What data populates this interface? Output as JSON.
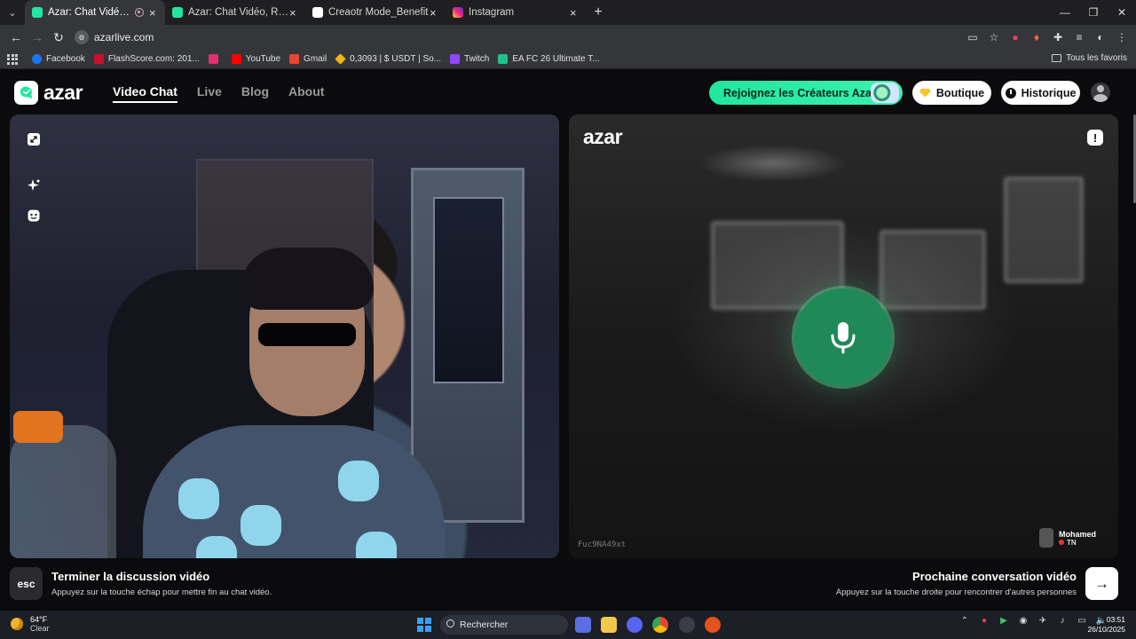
{
  "browser": {
    "tabs": [
      {
        "title": "Azar: Chat Vidéo, Rencontrer...",
        "active": true,
        "favicon_color": "#22e6a0",
        "recording": true
      },
      {
        "title": "Azar: Chat Vidéo, Rencontrer de...",
        "active": false,
        "favicon_color": "#22e6a0"
      },
      {
        "title": "Creaotr Mode_Benefit",
        "active": false,
        "favicon_color": "#ffffff"
      },
      {
        "title": "Instagram",
        "active": false,
        "favicon_color": "#e1306c"
      }
    ],
    "url": "azarlive.com",
    "bookmarks": [
      {
        "label": "Facebook",
        "color": "#1877f2"
      },
      {
        "label": "FlashScore.com: 201...",
        "color": "#c8102e"
      },
      {
        "label": "",
        "color": "#e1306c"
      },
      {
        "label": "YouTube",
        "color": "#ff0000"
      },
      {
        "label": "Gmail",
        "color": "#ea4335"
      },
      {
        "label": "0,3093 | $ USDT | So...",
        "color": "#f0b90b"
      },
      {
        "label": "Twitch",
        "color": "#9146ff"
      },
      {
        "label": "EA FC 26 Ultimate T...",
        "color": "#1ec38b"
      }
    ],
    "bookmarks_folder": "Tous les favoris"
  },
  "header": {
    "logo": "azar",
    "nav": [
      "Video Chat",
      "Live",
      "Blog",
      "About"
    ],
    "creators_button": "Rejoignez les Créateurs Azar",
    "shop_button": "Boutique",
    "history_button": "Historique"
  },
  "remote": {
    "watermark": "azar",
    "report_label": "!",
    "peer_id": "Fuc9NA49xt",
    "peer_name": "Mohamed",
    "peer_country": "TN"
  },
  "footer": {
    "esc_key": "esc",
    "end_title": "Terminer la discussion vidéo",
    "end_sub": "Appuyez sur la touche échap pour mettre fin au chat vidéo.",
    "next_title": "Prochaine conversation vidéo",
    "next_sub": "Appuyez sur la touche droite pour rencontrer d'autres personnes",
    "next_arrow": "→"
  },
  "taskbar": {
    "weather_temp": "64°F",
    "weather_cond": "Clear",
    "search_placeholder": "Rechercher",
    "time": "03:51",
    "date": "26/10/2025"
  },
  "colors": {
    "accent": "#22e6a0",
    "mic_green": "#1f8a58",
    "background": "#0b0b0d"
  }
}
